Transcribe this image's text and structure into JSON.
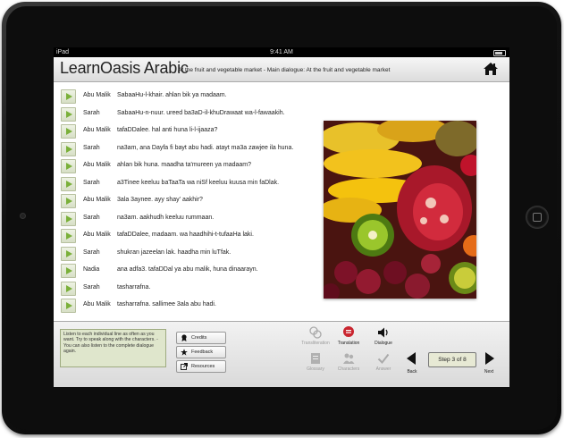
{
  "status_bar": {
    "carrier": "iPad",
    "time": "9:41 AM"
  },
  "header": {
    "brand": "LearnOasis Arabic",
    "subtitle": "At the fruit and vegetable market - Main dialogue: At the fruit and vegetable market"
  },
  "dialogue": [
    {
      "speaker": "Abu Malik",
      "text": "SabaaHu-l-khair. ahlan bik ya madaam."
    },
    {
      "speaker": "Sarah",
      "text": "SabaaHu-n-nuur. ureed ba3aD-il-khuDrawaat wa-l-fawaakih."
    },
    {
      "speaker": "Abu Malik",
      "text": "tafaDDalee. hal anti huna li-l-ijaaza?"
    },
    {
      "speaker": "Sarah",
      "text": "na3am, ana Dayfa fi bayt abu hadi. atayt ma3a zawjee ila huna."
    },
    {
      "speaker": "Abu Malik",
      "text": "ahlan bik huna. maadha ta'mureen ya madaam?"
    },
    {
      "speaker": "Sarah",
      "text": "a3Tinee keeluu baTaaTa wa niSf keeluu kuusa min faDlak."
    },
    {
      "speaker": "Abu Malik",
      "text": "3ala 3aynee. ayy shay' aakhir?"
    },
    {
      "speaker": "Sarah",
      "text": "na3am. aakhudh keeluu rummaan."
    },
    {
      "speaker": "Abu Malik",
      "text": "tafaDDalee, madaam. wa haadhihi-t-tufaaHa laki."
    },
    {
      "speaker": "Sarah",
      "text": "shukran jazeelan lak. haadha min luTfak."
    },
    {
      "speaker": "Nadia",
      "text": "ana adfa3. tafaDDal ya abu malik, huna dinaarayn."
    },
    {
      "speaker": "Sarah",
      "text": "tasharrafna."
    },
    {
      "speaker": "Abu Malik",
      "text": "tasharrafna. sallimee 3ala abu hadi."
    }
  ],
  "footer": {
    "instructions": "Listen to each individual line as often as you want. Try to speak along with the characters. - You can also listen to the complete dialogue again.",
    "buttons": {
      "credits": "Credits",
      "feedback": "Feedback",
      "resources": "Resources"
    },
    "tools": {
      "transliteration": "Transliteration",
      "translation": "Translation",
      "dialogue": "Dialogue",
      "glossary": "Glossary",
      "characters": "Characters",
      "answer": "Answer"
    },
    "nav": {
      "back": "Back",
      "next": "Next",
      "step": "Step 3 of 8"
    }
  },
  "colors": {
    "play_arrow": "#7ab03a",
    "instructions_bg": "#dfe6cc",
    "step_bg": "#e7e9d4"
  }
}
